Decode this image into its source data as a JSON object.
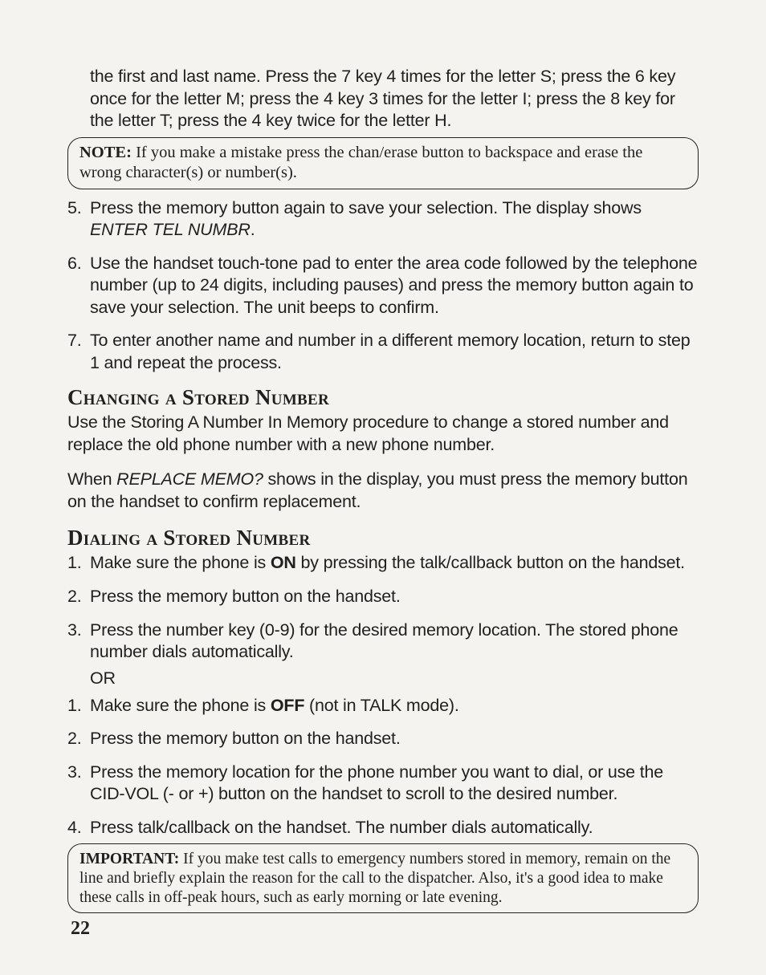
{
  "continuation_text": "the first and last name. Press the 7 key 4 times for the letter S; press the 6 key once for the letter M; press the 4 key 3 times for the letter I; press the 8 key for the letter T; press the 4 key twice for the letter H.",
  "note": {
    "label": "NOTE:",
    "text": " If you make a mistake press the chan/erase button to backspace and erase the wrong character(s) or number(s)."
  },
  "steps_a": [
    {
      "num": "5.",
      "pre": "Press the memory button again to save your selection. The display shows ",
      "italic": "ENTER TEL NUMBR",
      "post": "."
    },
    {
      "num": "6.",
      "pre": "Use the handset touch-tone pad to enter the area code followed by the telephone number (up to 24 digits, including pauses) and press the memory button again to save your selection. The unit beeps to confirm.",
      "italic": "",
      "post": ""
    },
    {
      "num": "7.",
      "pre": "To enter another name and number in a different memory location, return to step 1 and repeat the process.",
      "italic": "",
      "post": ""
    }
  ],
  "heading_changing": "Changing a Stored Number",
  "para_changing": "Use the Storing A Number In Memory procedure to change a stored number and replace the old phone number with a new phone number.",
  "para_replace_pre": "When ",
  "para_replace_italic": "REPLACE MEMO?",
  "para_replace_post": " shows in the display, you must press the memory button on the handset to confirm replacement.",
  "heading_dialing": "Dialing a Stored Number",
  "steps_b": [
    {
      "num": "1.",
      "pre": "Make sure the phone is ",
      "bold": "ON",
      "post": " by pressing the talk/callback button on the handset."
    },
    {
      "num": "2.",
      "pre": "Press the memory button on the handset.",
      "bold": "",
      "post": ""
    },
    {
      "num": "3.",
      "pre": "Press the number key (0-9) for the desired memory location. The stored phone number dials automatically.",
      "bold": "",
      "post": ""
    }
  ],
  "or_text": "OR",
  "steps_c": [
    {
      "num": "1.",
      "pre": "Make sure the phone is ",
      "bold": "OFF",
      "post": " (not in TALK mode)."
    },
    {
      "num": "2.",
      "pre": "Press the memory button on the handset.",
      "bold": "",
      "post": ""
    },
    {
      "num": "3.",
      "pre": "Press the memory location for the phone number you want to dial, or use the CID-VOL (- or +) button on the handset to scroll to the desired number.",
      "bold": "",
      "post": ""
    },
    {
      "num": "4.",
      "pre": "Press talk/callback on the handset. The number dials automatically.",
      "bold": "",
      "post": ""
    }
  ],
  "important": {
    "label": "IMPORTANT:",
    "text": " If you make test calls to emergency numbers stored in memory, remain on the line and briefly explain the reason for the call to the dispatcher. Also, it's a good idea to make these calls in off-peak hours, such as early morning or late evening."
  },
  "page_number": "22"
}
